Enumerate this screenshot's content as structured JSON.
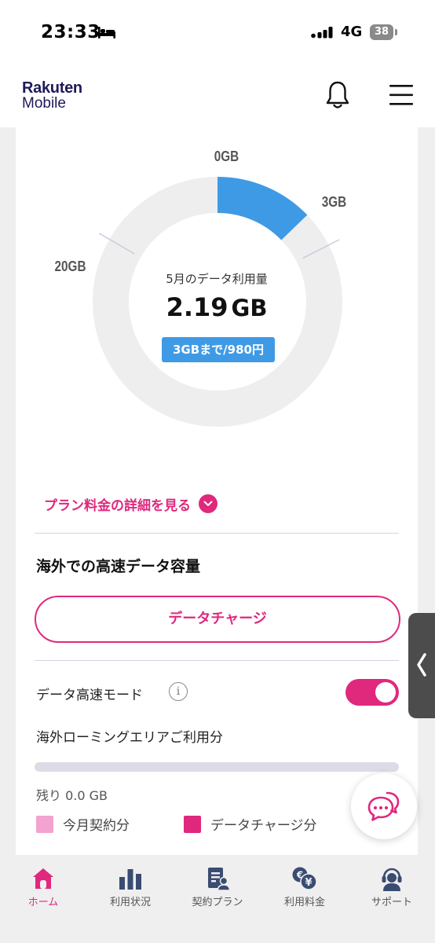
{
  "status_bar": {
    "time": "23:33",
    "network": "4G",
    "battery": "38"
  },
  "header": {
    "logo_line1": "Rakuten",
    "logo_line2": "Mobile"
  },
  "usage_gauge": {
    "label_start": "0GB",
    "label_tier1": "3GB",
    "label_tier2": "20GB",
    "caption": "5月のデータ利用量",
    "value": "2.19",
    "unit": "GB",
    "price_badge": "3GBまで/980円",
    "used_gb": 2.19,
    "tier1_gb": 3,
    "tier2_gb": 20
  },
  "plan_detail_link": "プラン料金の詳細を見る",
  "overseas": {
    "title": "海外での高速データ容量",
    "charge_button": "データチャージ",
    "speed_mode_label": "データ高速モード",
    "speed_mode_on": true,
    "roaming_label": "海外ローミングエリアご利用分",
    "roaming_fill_fraction": 0,
    "remaining": "残り 0.0 GB",
    "legend": [
      {
        "label": "今月契約分",
        "color": "#f2a3cf"
      },
      {
        "label": "データチャージ分",
        "color": "#e0287d"
      }
    ]
  },
  "bottom_nav": [
    {
      "label": "ホーム",
      "active": true
    },
    {
      "label": "利用状況",
      "active": false
    },
    {
      "label": "契約プラン",
      "active": false
    },
    {
      "label": "利用料金",
      "active": false
    },
    {
      "label": "サポート",
      "active": false
    }
  ],
  "colors": {
    "accent": "#e0287d",
    "gauge_fill": "#3f9ae6",
    "gauge_track": "#eeeeee"
  }
}
